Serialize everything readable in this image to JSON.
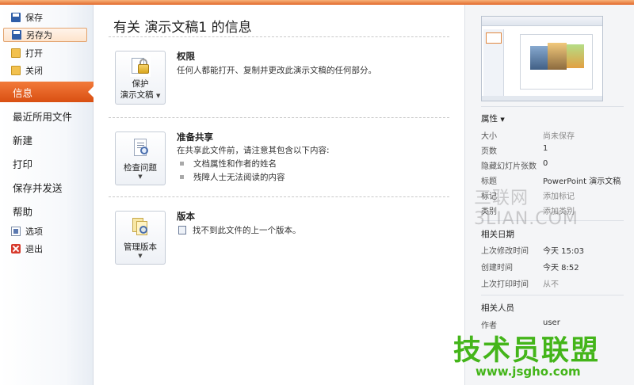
{
  "sidebar": {
    "top_items": [
      {
        "label": "保存",
        "icon": "save-icon"
      },
      {
        "label": "另存为",
        "icon": "save-as-icon",
        "selected": true
      },
      {
        "label": "打开",
        "icon": "open-folder-icon"
      },
      {
        "label": "关闭",
        "icon": "close-folder-icon"
      }
    ],
    "main_items": [
      {
        "label": "信息",
        "active": true
      },
      {
        "label": "最近所用文件"
      },
      {
        "label": "新建"
      },
      {
        "label": "打印"
      },
      {
        "label": "保存并发送"
      },
      {
        "label": "帮助"
      }
    ],
    "bottom_items": [
      {
        "label": "选项",
        "icon": "options-icon"
      },
      {
        "label": "退出",
        "icon": "exit-icon"
      }
    ]
  },
  "main": {
    "title": "有关 演示文稿1 的信息",
    "sections": [
      {
        "button": {
          "line1": "保护",
          "line2": "演示文稿",
          "has_dropdown": true
        },
        "title": "权限",
        "text": "任何人都能打开、复制并更改此演示文稿的任何部分。"
      },
      {
        "button": {
          "line1": "检查问题",
          "has_dropdown": true
        },
        "title": "准备共享",
        "text": "在共享此文件前，请注意其包含以下内容:",
        "bullets": [
          "文档属性和作者的姓名",
          "残障人士无法阅读的内容"
        ]
      },
      {
        "button": {
          "line1": "管理版本",
          "has_dropdown": true
        },
        "title": "版本",
        "text": "找不到此文件的上一个版本。"
      }
    ]
  },
  "right_panel": {
    "properties_header": "属性",
    "properties": [
      {
        "key": "大小",
        "value": "尚未保存",
        "muted": true
      },
      {
        "key": "页数",
        "value": "1"
      },
      {
        "key": "隐藏幻灯片张数",
        "value": "0"
      },
      {
        "key": "标题",
        "value": "PowerPoint 演示文稿"
      },
      {
        "key": "标记",
        "value": "添加标记",
        "muted": true
      },
      {
        "key": "类别",
        "value": "添加类别",
        "muted": true
      }
    ],
    "dates_header": "相关日期",
    "dates": [
      {
        "key": "上次修改时间",
        "value": "今天 15:03"
      },
      {
        "key": "创建时间",
        "value": "今天 8:52"
      },
      {
        "key": "上次打印时间",
        "value": "从不",
        "muted": true
      }
    ],
    "people_header": "相关人员",
    "people": [
      {
        "key": "作者",
        "value": "user"
      }
    ]
  },
  "watermarks": {
    "site1": "三联网 3LIAN.COM",
    "site2": "技术员联盟",
    "site2_url": "www.jsgho.com"
  },
  "colors": {
    "accent": "#e2692b",
    "active_nav": "#d94f12",
    "watermark_green": "#44b51a"
  }
}
